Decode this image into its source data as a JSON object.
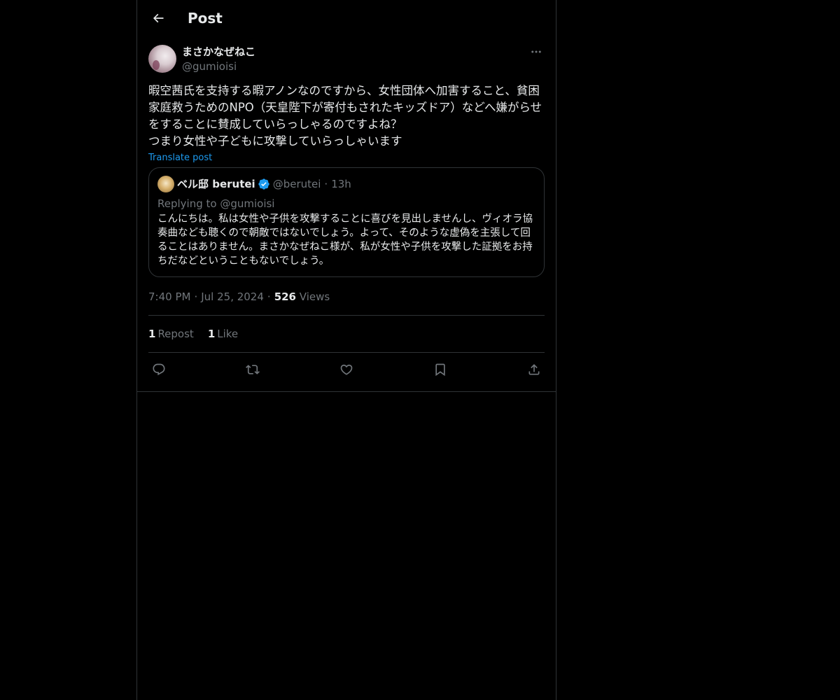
{
  "header": {
    "title": "Post",
    "back_icon": "arrow-left-icon"
  },
  "post": {
    "author": {
      "display_name": "まさかなぜねこ",
      "handle": "@gumioisi"
    },
    "text": "暇空茜氏を支持する暇アノンなのですから、女性団体へ加害すること、貧困家庭救うためのNPO（天皇陛下が寄付もされたキッズドア）などへ嫌がらせをすることに賛成していらっしゃるのですよね？\nつまり女性や子どもに攻撃していらっしゃいます",
    "translate_label": "Translate post",
    "quoted": {
      "display_name": "ベル邸 berutei",
      "handle": "@berutei",
      "dot": "·",
      "time": "13h",
      "replying_prefix": "Replying to ",
      "replying_handle": "@gumioisi",
      "text": "こんにちは。私は女性や子供を攻撃することに喜びを見出しませんし、ヴィオラ協奏曲なども聴くので朝敵ではないでしょう。よって、そのような虚偽を主張して回ることはありません。まさかなぜねこ様が、私が女性や子供を攻撃した証拠をお持ちだなどということもないでしょう。"
    },
    "meta": {
      "time": "7:40 PM",
      "sep1": "·",
      "date": "Jul 25, 2024",
      "sep2": "·",
      "views_count": "526",
      "views_label": " Views"
    },
    "stats": {
      "reposts_count": "1",
      "reposts_label": "Repost",
      "likes_count": "1",
      "likes_label": "Like"
    },
    "actions": [
      "reply-icon",
      "repost-icon",
      "like-icon",
      "bookmark-icon",
      "share-icon"
    ]
  },
  "colors": {
    "background": "#000000",
    "text_primary": "#e7e9ea",
    "text_secondary": "#71767b",
    "accent": "#1d9bf0",
    "border": "#2f3336"
  }
}
